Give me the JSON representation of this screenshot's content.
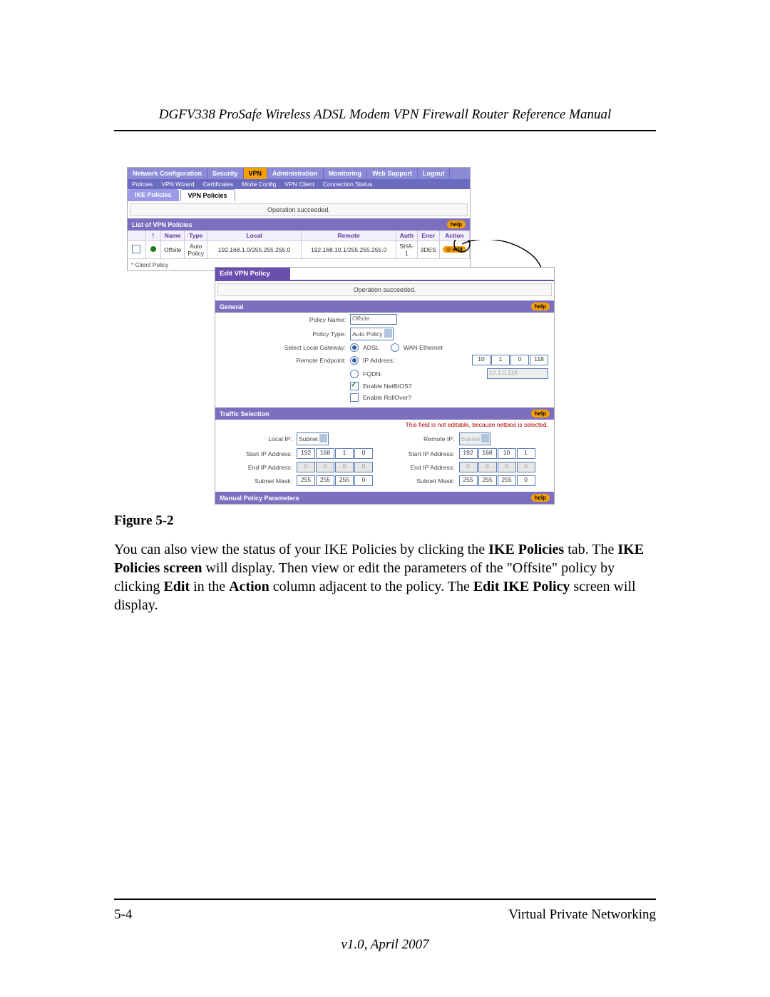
{
  "doc": {
    "running_header": "DGFV338 ProSafe Wireless ADSL Modem VPN Firewall Router Reference Manual",
    "figure_caption": "Figure 5-2",
    "body_html_parts": {
      "p1a": "You can also view the status of your IKE Policies by clicking the ",
      "p1b": "IKE Policies",
      "p1c": " tab. The ",
      "p1d": "IKE Policies screen",
      "p1e": " will display. Then view or edit the parameters of the \"Offsite\" policy by clicking ",
      "p1f": "Edit",
      "p1g": " in the ",
      "p1h": "Action",
      "p1i": " column adjacent to the policy. The ",
      "p1j": "Edit IKE Policy",
      "p1k": " screen will display."
    },
    "footer_page": "5-4",
    "footer_chapter": "Virtual Private Networking",
    "version": "v1.0, April 2007"
  },
  "ui1": {
    "nav": [
      "Network Configuration",
      "Security",
      "VPN",
      "Administration",
      "Monitoring",
      "Web Support",
      "Logout"
    ],
    "subnav": [
      "Policies",
      "VPN Wizard",
      "Certificates",
      "Mode Config",
      "VPN Client",
      "Connection Status"
    ],
    "tab_ike": "IKE Policies",
    "tab_vpn": "VPN Policies",
    "operation_msg": "Operation succeeded.",
    "list_title": "List of VPN Policies",
    "help": "help",
    "cols": {
      "bang": "!",
      "name": "Name",
      "type": "Type",
      "local": "Local",
      "remote": "Remote",
      "auth": "Auth",
      "encr": "Encr",
      "action": "Action"
    },
    "row": {
      "name": "Offsite",
      "type": "Auto Policy",
      "local": "192.168.1.0/255.255.255.0",
      "remote": "192.168.10.1/255.255.255.0",
      "auth": "SHA-1",
      "encr": "3DES",
      "action": "edit"
    },
    "client_policy": "* Client Policy"
  },
  "ui2": {
    "title": "Edit VPN Policy",
    "operation_msg": "Operation succeeded.",
    "section_general": "General",
    "section_traffic": "Traffic Selection",
    "section_manual": "Manual Policy Parameters",
    "help": "help",
    "general": {
      "policy_name_label": "Policy Name:",
      "policy_name_value": "Offsite",
      "policy_type_label": "Policy Type:",
      "policy_type_value": "Auto Policy",
      "gateway_label": "Select Local Gateway:",
      "gateway_opt_adsl": "ADSL",
      "gateway_opt_wan": "WAN Ethernet",
      "remote_ep_label": "Remote Endpoint:",
      "remote_ep_ip": "IP Address:",
      "remote_ep_fqdn": "FQDN:",
      "remote_ip": [
        "10",
        "1",
        "0",
        "118"
      ],
      "fqdn_value": "10.1.0.118",
      "enable_netbios": "Enable NetBIOS?",
      "enable_rollover": "Enable RollOver?"
    },
    "traffic": {
      "note": "This field is not editable, because netbios is selected.",
      "local_ip_label": "Local IP:",
      "local_ip_mode": "Subnet",
      "remote_ip_label": "Remote IP:",
      "remote_ip_mode": "Subnet",
      "start_label": "Start IP Address:",
      "end_label": "End IP Address:",
      "mask_label": "Subnet Mask:",
      "local_start": [
        "192",
        "168",
        "1",
        "0"
      ],
      "local_end": [
        "0",
        "0",
        "0",
        "0"
      ],
      "local_mask": [
        "255",
        "255",
        "255",
        "0"
      ],
      "remote_start": [
        "192",
        "168",
        "10",
        "1"
      ],
      "remote_end": [
        "0",
        "0",
        "0",
        "0"
      ],
      "remote_mask": [
        "255",
        "255",
        "255",
        "0"
      ]
    }
  }
}
